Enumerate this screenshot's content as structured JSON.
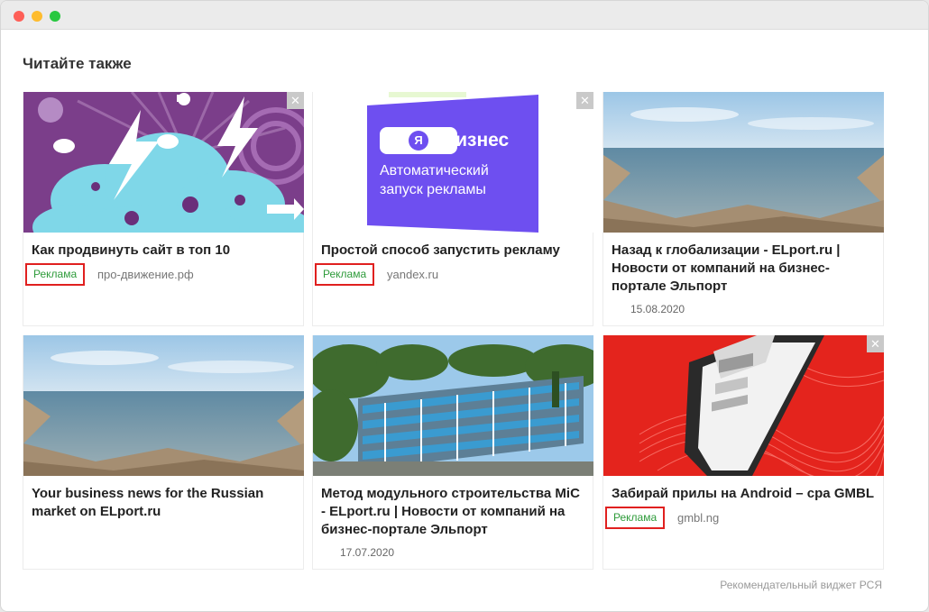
{
  "window": {
    "controls": [
      "close",
      "minimize",
      "maximize"
    ]
  },
  "section": {
    "title": "Читайте также"
  },
  "cards": [
    {
      "title": "Как продвинуть сайт в топ 10",
      "badge": "Реклама",
      "source": "про-движение.рф",
      "image": "brain-cloud-illustration",
      "close": "✕"
    },
    {
      "title": "Простой способ запустить рекламу",
      "badge": "Реклама",
      "source": "yandex.ru",
      "image": "yandex-business-ad",
      "logo_letter": "Я",
      "logo_text": "Бизнес",
      "image_text_1": "Автоматический",
      "image_text_2": "запуск рекламы",
      "close": "✕"
    },
    {
      "title": "Назад к глобализации - ELport.ru | Новости от компаний на бизнес-портале Эльпорт",
      "date": "15.08.2020",
      "image": "sea-shore-photo"
    },
    {
      "title": "Your business news for the Russian market on ELport.ru",
      "image": "sea-shore-photo"
    },
    {
      "title": "Метод модульного строительства MiC - ELport.ru | Новости от компаний на бизнес-портале Эльпорт",
      "date": "17.07.2020",
      "image": "modular-building-photo"
    },
    {
      "title": "Забирай прилы на Android – cpa GMBL",
      "badge": "Реклама",
      "source": "gmbl.ng",
      "image": "phone-atm-illustration",
      "close": "✕"
    }
  ],
  "footer": {
    "text": "Рекомендательный виджет РСЯ"
  },
  "colors": {
    "badge_border": "#e0201f",
    "badge_text": "#2e9b3a",
    "yandex_purple": "#6e4ff0"
  }
}
